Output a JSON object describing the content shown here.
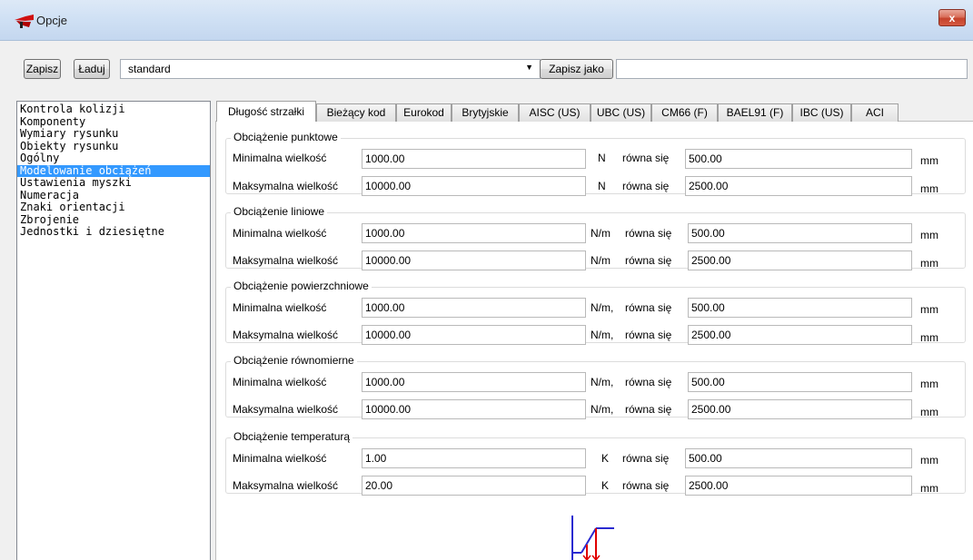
{
  "window": {
    "title": "Opcje",
    "close_label": "x"
  },
  "toolbar": {
    "save_label": "Zapisz",
    "load_label": "Ładuj",
    "preset_value": "standard",
    "save_as_label": "Zapisz jako",
    "save_as_name": ""
  },
  "categories": [
    "Kontrola kolizji",
    "Komponenty",
    "Wymiary rysunku",
    "Obiekty rysunku",
    "Ogólny",
    "Modelowanie obciążeń",
    "Ustawienia myszki",
    "Numeracja",
    "Znaki orientacji",
    "Zbrojenie",
    "Jednostki i dziesiętne"
  ],
  "selected_category": "Modelowanie obciążeń",
  "tabs": [
    "Długość strzałki",
    "Bieżący kod",
    "Eurokod",
    "Brytyjskie",
    "AISC (US)",
    "UBC (US)",
    "CM66 (F)",
    "BAEL91 (F)",
    "IBC (US)",
    "ACI"
  ],
  "active_tab": "Długość strzałki",
  "labels": {
    "min": "Minimalna wielkość",
    "max": "Maksymalna wielkość",
    "equals": "równa się",
    "mm": "mm"
  },
  "groups": [
    {
      "title": "Obciążenie punktowe",
      "unit": "N",
      "min_value": "1000.00",
      "min_length": "500.00",
      "max_value": "10000.00",
      "max_length": "2500.00"
    },
    {
      "title": "Obciążenie liniowe",
      "unit": "N/m",
      "min_value": "1000.00",
      "min_length": "500.00",
      "max_value": "10000.00",
      "max_length": "2500.00"
    },
    {
      "title": "Obciążenie powierzchniowe",
      "unit": "N/m,",
      "min_value": "1000.00",
      "min_length": "500.00",
      "max_value": "10000.00",
      "max_length": "2500.00"
    },
    {
      "title": "Obciążenie równomierne",
      "unit": "N/m,",
      "min_value": "1000.00",
      "min_length": "500.00",
      "max_value": "10000.00",
      "max_length": "2500.00"
    },
    {
      "title": "Obciążenie temperaturą",
      "unit": "K",
      "min_value": "1.00",
      "min_length": "500.00",
      "max_value": "20.00",
      "max_length": "2500.00"
    }
  ],
  "colors": {
    "selection": "#3399ff",
    "arrow": "#e00000",
    "line": "#2a2ad0"
  }
}
